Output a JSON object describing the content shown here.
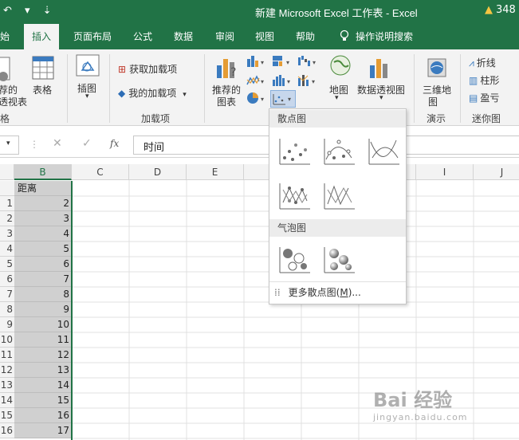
{
  "titlebar": {
    "qa": "↶ ▾ ⇣",
    "title": "新建 Microsoft Excel 工作表 - Excel",
    "warning_text": "348"
  },
  "tabs": [
    {
      "label": "开始"
    },
    {
      "label": "插入"
    },
    {
      "label": "页面布局"
    },
    {
      "label": "公式"
    },
    {
      "label": "数据"
    },
    {
      "label": "审阅"
    },
    {
      "label": "视图"
    },
    {
      "label": "帮助"
    },
    {
      "label": "操作说明搜索"
    }
  ],
  "ribbon": {
    "pivot_label_1": "荐的",
    "pivot_label_2": "透视表",
    "table_label": "表格",
    "tables_group": "格",
    "illustrations_label": "插图",
    "get_addins": "获取加载项",
    "my_addins": "我的加载项",
    "addins_group": "加载项",
    "recommended_charts_1": "推荐的",
    "recommended_charts_2": "图表",
    "map_label": "地图",
    "pivot_chart_label": "数据透视图",
    "map3d_label_1": "三维地",
    "map3d_label_2": "图",
    "tours_group": "演示",
    "spark_line": "折线",
    "spark_column": "柱形",
    "spark_winloss": "盈亏",
    "sparklines_group": "迷你图"
  },
  "formula_bar": {
    "fx": "fx",
    "value": "时间"
  },
  "columns": [
    "B",
    "C",
    "D",
    "E",
    "I",
    "J"
  ],
  "column_b_header": "距离",
  "rows": [
    {
      "n": "1",
      "v": "2"
    },
    {
      "n": "2",
      "v": "3"
    },
    {
      "n": "3",
      "v": "4"
    },
    {
      "n": "4",
      "v": "5"
    },
    {
      "n": "5",
      "v": "6"
    },
    {
      "n": "6",
      "v": "7"
    },
    {
      "n": "7",
      "v": "8"
    },
    {
      "n": "8",
      "v": "9"
    },
    {
      "n": "9",
      "v": "10"
    },
    {
      "n": "10",
      "v": "11"
    },
    {
      "n": "11",
      "v": "12"
    },
    {
      "n": "12",
      "v": "13"
    },
    {
      "n": "13",
      "v": "14"
    },
    {
      "n": "14",
      "v": "15"
    },
    {
      "n": "15",
      "v": "16"
    },
    {
      "n": "16",
      "v": "17"
    }
  ],
  "dropdown": {
    "scatter_header": "散点图",
    "bubble_header": "气泡图",
    "more_prefix": "更多散点图(",
    "more_key": "M",
    "more_suffix": ")..."
  },
  "watermark": {
    "text": "Bai 经验",
    "sub": "jingyan.baidu.com"
  },
  "colors": {
    "brand": "#217346",
    "ribbon": "#f3f3f3",
    "selection": "#d0d0d0"
  }
}
